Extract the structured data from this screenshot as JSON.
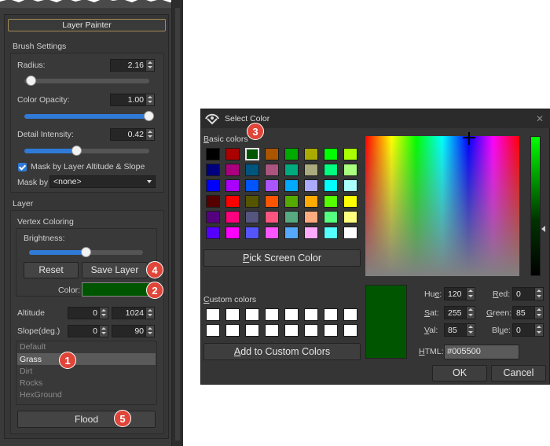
{
  "left_panel": {
    "title": "Layer Painter",
    "brush_settings": {
      "heading": "Brush Settings",
      "radius": {
        "label": "Radius:",
        "value": "2.16",
        "slider_level": 0.05
      },
      "color_opacity": {
        "label": "Color Opacity:",
        "value": "1.00",
        "slider_level": 1.0
      },
      "detail_intensity": {
        "label": "Detail Intensity:",
        "value": "0.42",
        "slider_level": 0.42
      },
      "mask_checkbox": {
        "label": "Mask by Layer Altitude & Slope",
        "checked": true
      },
      "mask_by": {
        "label": "Mask by",
        "value": "<none>"
      }
    },
    "layer": {
      "heading": "Layer",
      "vertex_coloring": {
        "heading": "Vertex Coloring",
        "brightness": {
          "label": "Brightness:",
          "slider_level": 0.5
        },
        "reset_label": "Reset",
        "save_label": "Save Layer",
        "color_label": "Color:",
        "color_value": "#005500"
      },
      "altitude": {
        "label": "Altitude",
        "min": "0",
        "max": "1024"
      },
      "slope": {
        "label": "Slope(deg.)",
        "min": "0",
        "max": "90"
      },
      "layers": [
        "Default",
        "Grass",
        "Dirt",
        "Rocks",
        "HexGround"
      ],
      "selected_layer": "Grass",
      "flood_label": "Flood"
    }
  },
  "dialog": {
    "title": "Select Color",
    "basic_colors_label": "Basic colors",
    "basic_colors": [
      [
        "#000000",
        "#aa0000",
        "#005500",
        "#aa5500",
        "#00aa00",
        "#aaaa00",
        "#00ff00",
        "#aaff00"
      ],
      [
        "#00007f",
        "#aa007f",
        "#00557f",
        "#aa557f",
        "#00aa7f",
        "#aaaa7f",
        "#00ff7f",
        "#aaff7f"
      ],
      [
        "#0000ff",
        "#aa00ff",
        "#0055ff",
        "#aa55ff",
        "#00aaff",
        "#aaaaff",
        "#00ffff",
        "#aaffff"
      ],
      [
        "#550000",
        "#ff0000",
        "#555500",
        "#ff5500",
        "#55aa00",
        "#ffaa00",
        "#55ff00",
        "#ffff00"
      ],
      [
        "#55007f",
        "#ff007f",
        "#55557f",
        "#ff557f",
        "#55aa7f",
        "#ffaa7f",
        "#55ff7f",
        "#ffff7f"
      ],
      [
        "#5500ff",
        "#ff00ff",
        "#5555ff",
        "#ff55ff",
        "#55aaff",
        "#ffaaff",
        "#55ffff",
        "#ffffff"
      ]
    ],
    "selected_basic": "#005500",
    "pick_screen_label": "Pick Screen Color",
    "custom_colors_label": "Custom colors",
    "add_custom_label": "Add to Custom Colors",
    "current_color": "#005500",
    "hue": {
      "label": "Hue:",
      "value": "120"
    },
    "sat": {
      "label": "Sat:",
      "value": "255"
    },
    "val": {
      "label": "Val:",
      "value": "85"
    },
    "red": {
      "label": "Red:",
      "value": "0"
    },
    "green": {
      "label": "Green:",
      "value": "85"
    },
    "blue": {
      "label": "Blue:",
      "value": "0"
    },
    "html_label": "HTML:",
    "html_value": "#005500",
    "ok_label": "OK",
    "cancel_label": "Cancel",
    "close_icon": "close-icon"
  },
  "badges": [
    "1",
    "2",
    "3",
    "4",
    "5"
  ]
}
